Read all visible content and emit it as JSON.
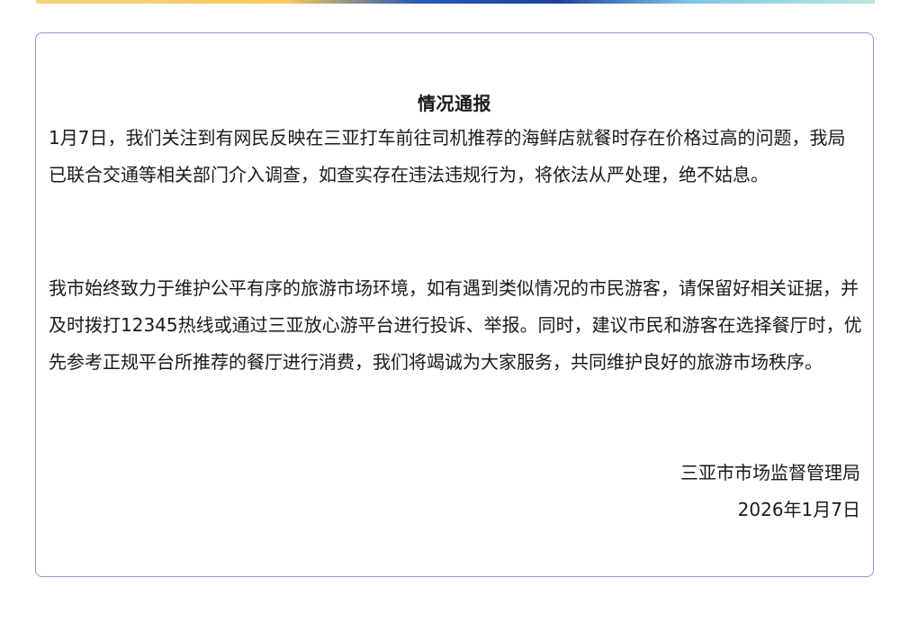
{
  "notice": {
    "title": "情况通报",
    "paragraphs": [
      "1月7日，我们关注到有网民反映在三亚打车前往司机推荐的海鲜店就餐时存在价格过高的问题，我局已联合交通等相关部门介入调查，如查实存在违法违规行为，将依法从严处理，绝不姑息。",
      "我市始终致力于维护公平有序的旅游市场环境，如有遇到类似情况的市民游客，请保留好相关证据，并及时拨打12345热线或通过三亚放心游平台进行投诉、举报。同时，建议市民和游客在选择餐厅时，优先参考正规平台所推荐的餐厅进行消费，我们将竭诚为大家服务，共同维护良好的旅游市场秩序。"
    ],
    "issuer": "三亚市市场监督管理局",
    "date": "2026年1月7日"
  }
}
